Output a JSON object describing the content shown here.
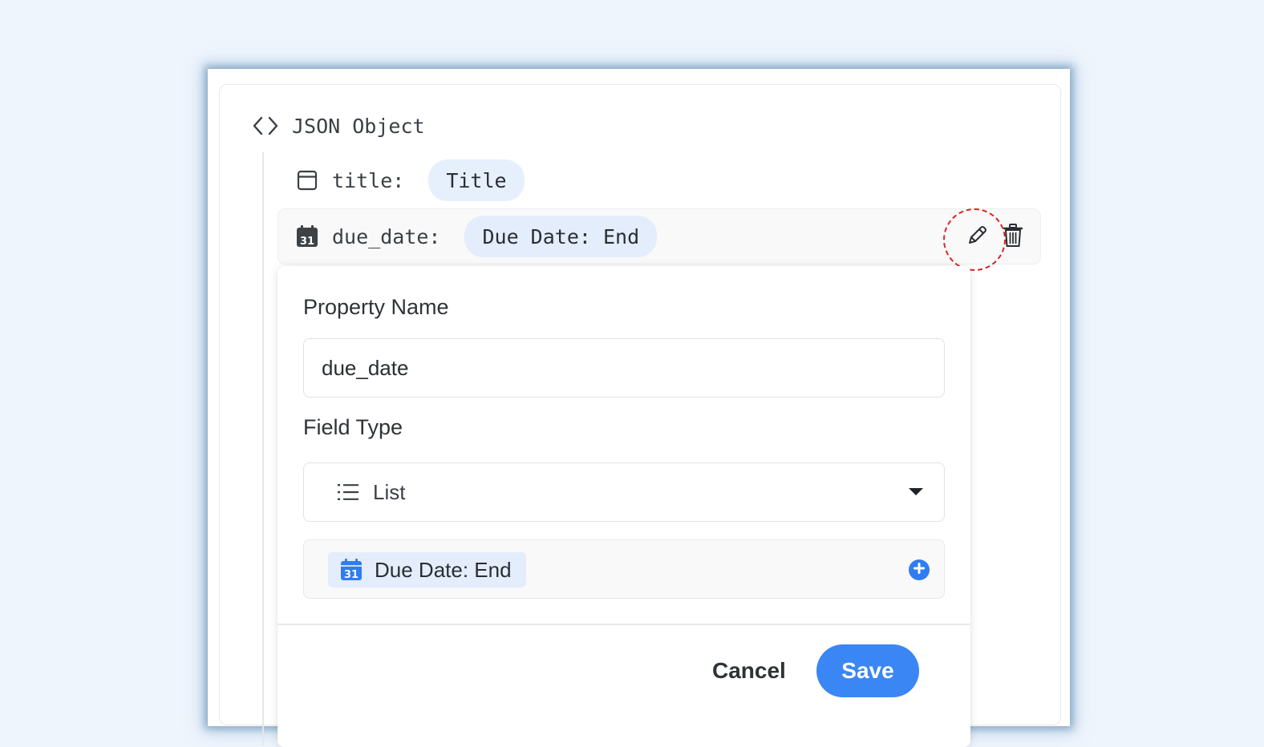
{
  "object": {
    "header_label": "JSON Object",
    "header_icon": "code-brackets-icon"
  },
  "properties": [
    {
      "icon": "window-icon",
      "key": "title:",
      "value": "Title"
    },
    {
      "icon": "calendar-icon",
      "key": "due_date:",
      "value": "Due Date: End"
    }
  ],
  "row_actions": {
    "edit_icon": "pencil-icon",
    "delete_icon": "trash-icon",
    "highlight_color": "#e02424"
  },
  "editor": {
    "property_name_label": "Property Name",
    "property_name_value": "due_date",
    "field_type_label": "Field Type",
    "field_type_value": "List",
    "field_type_icon": "list-icon",
    "list_items": [
      {
        "icon": "calendar-icon",
        "label": "Due Date: End"
      }
    ],
    "add_icon": "plus-circle-icon",
    "cancel_label": "Cancel",
    "save_label": "Save"
  },
  "colors": {
    "accent": "#3a86f4",
    "chip_bg": "#e6f0fd",
    "page_bg": "#eff5fd"
  }
}
